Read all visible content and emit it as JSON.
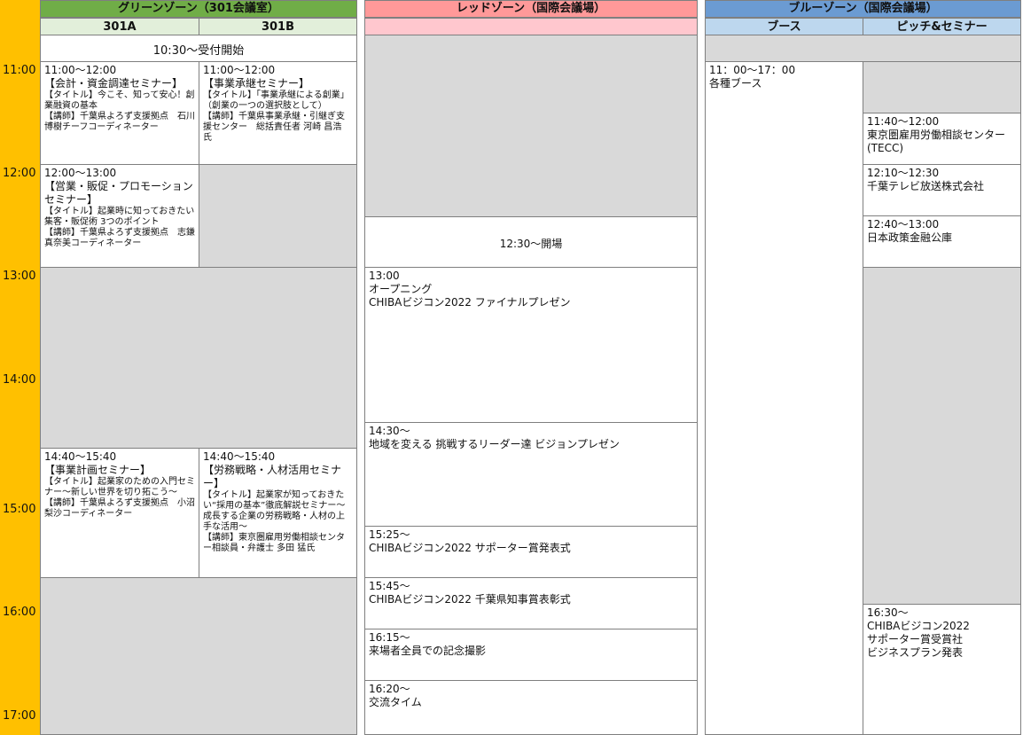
{
  "colors": {
    "time_column": "#ffc000",
    "green_zone_header": "#70ad47",
    "green_zone_subheader": "#e2efda",
    "red_zone_header": "#ff9999",
    "red_zone_subheader": "#ffc7ce",
    "blue_zone_header": "#6b9bd2",
    "blue_zone_subheader": "#bdd7ee",
    "empty_slot": "#d9d9d9"
  },
  "time_labels": [
    "11:00",
    "12:00",
    "13:00",
    "14:00",
    "15:00",
    "16:00",
    "17:00"
  ],
  "green_zone": {
    "title": "グリーンゾーン（301会議室）",
    "rooms": [
      "301A",
      "301B"
    ],
    "reception": "10:30～受付開始",
    "sessions": {
      "a1": {
        "time": "11:00～12:00",
        "name": "【会計・資金調達セミナー】",
        "detail": "【タイトル】今こそ、知って安心！創業融資の基本",
        "speaker": "【講師】千葉県よろず支援拠点　石川 博樹チーフコーディネーター"
      },
      "b1": {
        "time": "11:00～12:00",
        "name": "【事業承継セミナー】",
        "detail": "【タイトル】「事業承継による創業」（創業の一つの選択肢として）",
        "speaker": "【講師】千葉県事業承継・引継ぎ支援センター　総括責任者 河崎 昌浩 氏"
      },
      "a2": {
        "time": "12:00～13:00",
        "name": "【営業・販促・プロモーションセミナー】",
        "detail": "【タイトル】起業時に知っておきたい集客・販促術 3つのポイント",
        "speaker": "【講師】千葉県よろず支援拠点　志鎌 真奈美コーディネーター"
      },
      "a3": {
        "time": "14:40～15:40",
        "name": "【事業計画セミナー】",
        "detail": "【タイトル】起業家のための入門セミナー～新しい世界を切り拓こう～",
        "speaker": "【講師】千葉県よろず支援拠点　小沼 梨沙コーディネーター"
      },
      "b3": {
        "time": "14:40～15:40",
        "name": "【労務戦略・人材活用セミナー】",
        "detail": "【タイトル】起業家が知っておきたい“採用の基本”徹底解説セミナー～成長する企業の労務戦略・人材の上手な活用～",
        "speaker": "【講師】東京圏雇用労働相談センター相談員・弁護士 多田 猛氏"
      }
    }
  },
  "red_zone": {
    "title": "レッドゾーン（国際会議場）",
    "opening_doors": "12:30～開場",
    "events": [
      {
        "time": "13:00",
        "line1": "オープニング",
        "line2": "CHIBAビジコン2022 ファイナルプレゼン"
      },
      {
        "time": "14:30～",
        "line1": "地域を変える 挑戦するリーダー達 ビジョンプレゼン"
      },
      {
        "time": "15:25～",
        "line1": "CHIBAビジコン2022 サポーター賞発表式"
      },
      {
        "time": "15:45～",
        "line1": "CHIBAビジコン2022 千葉県知事賞表彰式"
      },
      {
        "time": "16:15～",
        "line1": "来場者全員での記念撮影"
      },
      {
        "time": "16:20～",
        "line1": "交流タイム"
      }
    ]
  },
  "blue_zone": {
    "title": "ブルーゾーン（国際会議場）",
    "columns": [
      "ブース",
      "ピッチ&セミナー"
    ],
    "booth": {
      "time": "11：00～17：00",
      "name": "各種ブース"
    },
    "pitch": [
      {
        "time": "11:40～12:00",
        "name": "東京圏雇用労働相談センター(TECC)"
      },
      {
        "time": "12:10～12:30",
        "name": "千葉テレビ放送株式会社"
      },
      {
        "time": "12:40～13:00",
        "name": "日本政策金融公庫"
      },
      {
        "time": "16:30～",
        "line1": "CHIBAビジコン2022",
        "line2": "サポーター賞受賞社",
        "line3": "ビジネスプラン発表"
      }
    ]
  }
}
